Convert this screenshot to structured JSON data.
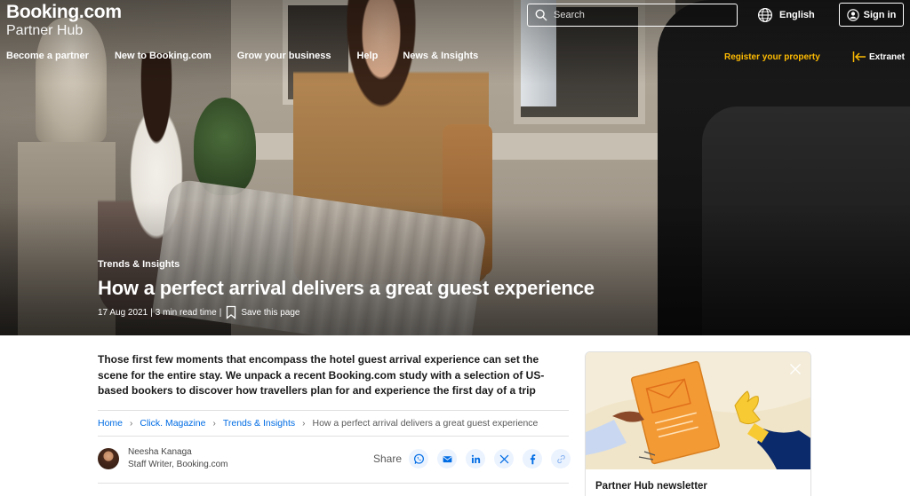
{
  "header": {
    "brand": "Booking.com",
    "sub_brand": "Partner Hub",
    "search": {
      "placeholder": "Search"
    },
    "language": "English",
    "sign_in": "Sign in",
    "nav": [
      "Become a partner",
      "New to Booking.com",
      "Grow your business",
      "Help",
      "News & Insights"
    ],
    "register": "Register your property",
    "extranet": "Extranet",
    "accent_color": "#febb02"
  },
  "hero": {
    "category": "Trends & Insights",
    "title": "How a perfect arrival delivers a great guest experience",
    "date": "17 Aug 2021",
    "separator": "|",
    "read_time": "3 min read time",
    "save": "Save this page"
  },
  "article": {
    "lead": "Those first few moments that encompass the hotel guest arrival experience can set the scene for the entire stay. We unpack a recent Booking.com study with a selection of US-based bookers to discover how travellers plan for and experience the first day of a trip",
    "breadcrumbs": [
      "Home",
      "Click. Magazine",
      "Trends & Insights",
      "How a perfect arrival delivers a great guest experience"
    ],
    "author": {
      "name": "Neesha Kanaga",
      "role": "Staff Writer, Booking.com"
    },
    "share": {
      "label": "Share",
      "icons": [
        "whatsapp-icon",
        "email-icon",
        "linkedin-icon",
        "x-icon",
        "facebook-icon",
        "link-icon"
      ]
    },
    "link_color": "#006ce4"
  },
  "sidebar": {
    "newsletter_title": "Partner Hub newsletter"
  }
}
